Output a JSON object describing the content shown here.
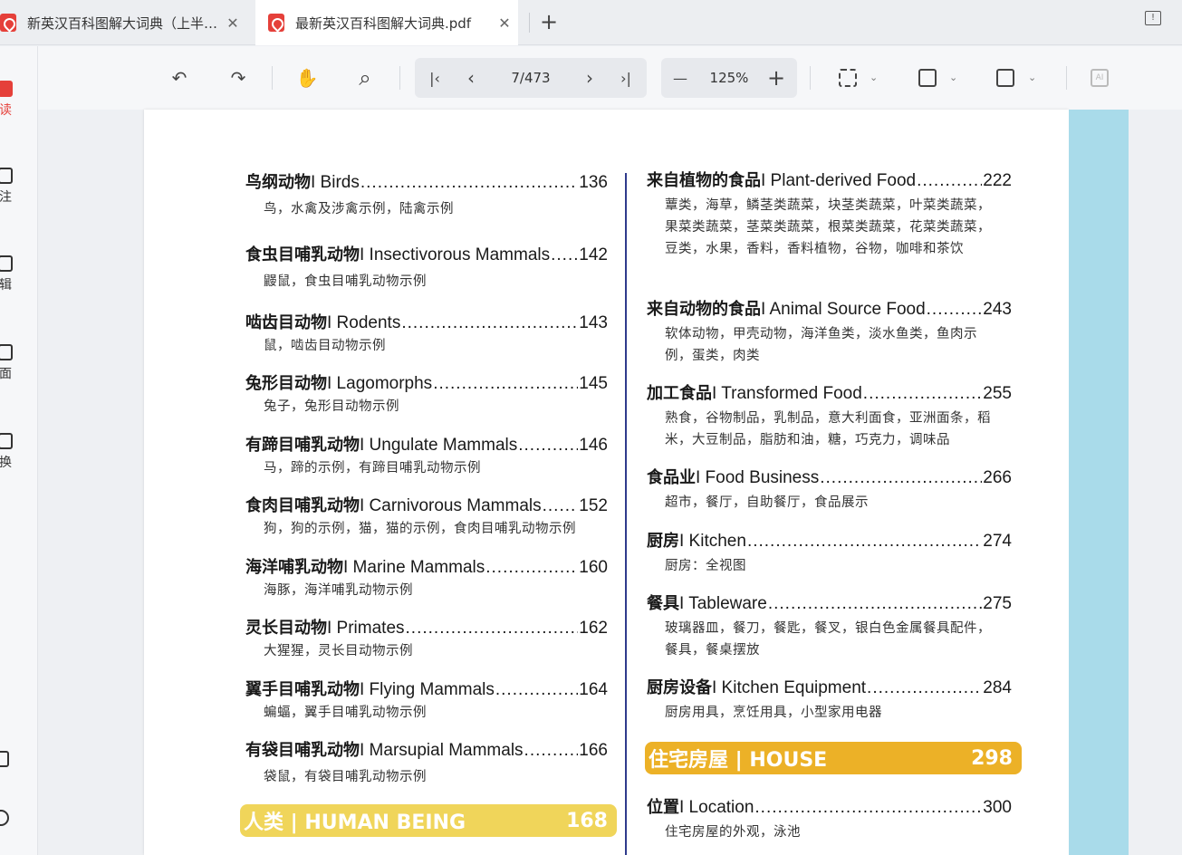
{
  "tabs": [
    {
      "title": "新英汉百科图解大词典（上半…",
      "close": "✕"
    },
    {
      "title": "最新英汉百科图解大词典.pdf",
      "close": "✕"
    }
  ],
  "new_tab": "+",
  "sidebar": {
    "items": [
      {
        "label": "读"
      },
      {
        "label": "注"
      },
      {
        "label": "辑"
      },
      {
        "label": "面"
      },
      {
        "label": "换"
      }
    ]
  },
  "toolbar": {
    "undo": "↶",
    "redo": "↷",
    "hand": "✋",
    "search": "⌕",
    "first_page": "|‹",
    "prev_page": "‹",
    "page_indicator": "7/473",
    "next_page": "›",
    "last_page": "›|",
    "zoom_out": "—",
    "zoom_value": "125%",
    "zoom_in": "+",
    "caret": "⌄",
    "ai": "AI"
  },
  "document": {
    "left_entries": [
      {
        "cn": "鸟纲动物",
        "en": " I Birds ",
        "page": "136",
        "desc": "鸟，水禽及涉禽示例，陆禽示例"
      },
      {
        "cn": "食虫目哺乳动物",
        "en": " I Insectivorous Mammals",
        "page": "142",
        "desc": "鼹鼠，食虫目哺乳动物示例"
      },
      {
        "cn": "啮齿目动物",
        "en": " I Rodents",
        "page": "143",
        "desc": "鼠，啮齿目动物示例"
      },
      {
        "cn": "兔形目动物",
        "en": " I Lagomorphs ",
        "page": "145",
        "desc": "兔子，兔形目动物示例"
      },
      {
        "cn": "有蹄目哺乳动物",
        "en": " I Ungulate Mammals",
        "page": "146",
        "desc": "马，蹄的示例，有蹄目哺乳动物示例"
      },
      {
        "cn": "食肉目哺乳动物",
        "en": " I Carnivorous Mammals",
        "page": "152",
        "desc": "狗，狗的示例，猫，猫的示例，食肉目哺乳动物示例"
      },
      {
        "cn": "海洋哺乳动物",
        "en": " I Marine Mammals",
        "page": "160",
        "desc": "海豚，海洋哺乳动物示例"
      },
      {
        "cn": "灵长目动物",
        "en": " I Primates",
        "page": "162",
        "desc": "大猩猩，灵长目动物示例"
      },
      {
        "cn": "翼手目哺乳动物",
        "en": " I Flying Mammals",
        "page": "164",
        "desc": "蝙蝠，翼手目哺乳动物示例"
      },
      {
        "cn": "有袋目哺乳动物",
        "en": " I Marsupial Mammals",
        "page": "166",
        "desc": "袋鼠，有袋目哺乳动物示例"
      }
    ],
    "left_banner": {
      "title": "人类 | HUMAN BEING",
      "page": "168"
    },
    "right_entries": [
      {
        "cn": "来自植物的食品",
        "en": " I Plant-derived Food ",
        "page": "222",
        "desc": "蕈类，海草，鳞茎类蔬菜，块茎类蔬菜，叶菜类蔬菜，果菜类蔬菜，茎菜类蔬菜，根菜类蔬菜，花菜类蔬菜，豆类，水果，香料，香料植物，谷物，咖啡和茶饮"
      },
      {
        "cn": "来自动物的食品",
        "en": " I Animal Source Food ",
        "page": "243",
        "desc": "软体动物，甲壳动物，海洋鱼类，淡水鱼类，鱼肉示例，蛋类，肉类"
      },
      {
        "cn": "加工食品",
        "en": " I Transformed Food ",
        "page": "255",
        "desc": "熟食，谷物制品，乳制品，意大利面食，亚洲面条，稻米，大豆制品，脂肪和油，糖，巧克力，调味品"
      },
      {
        "cn": "食品业",
        "en": " I Food Business ",
        "page": "266",
        "desc": "超市，餐厅，自助餐厅，食品展示"
      },
      {
        "cn": "厨房",
        "en": " I Kitchen",
        "page": "274",
        "desc": "厨房：全视图"
      },
      {
        "cn": "餐具",
        "en": " I Tableware ",
        "page": "275",
        "desc": "玻璃器皿，餐刀，餐匙，餐叉，银白色金属餐具配件，餐具，餐桌摆放"
      },
      {
        "cn": "厨房设备",
        "en": " I Kitchen Equipment ",
        "page": "284",
        "desc": "厨房用具，烹饪用具，小型家用电器"
      }
    ],
    "right_banner": {
      "title": "住宅房屋 | HOUSE",
      "page": "298"
    },
    "right_entries_after": [
      {
        "cn": "位置",
        "en": " I Location ",
        "page": "300",
        "desc": "住宅房屋的外观，泳池"
      }
    ]
  }
}
